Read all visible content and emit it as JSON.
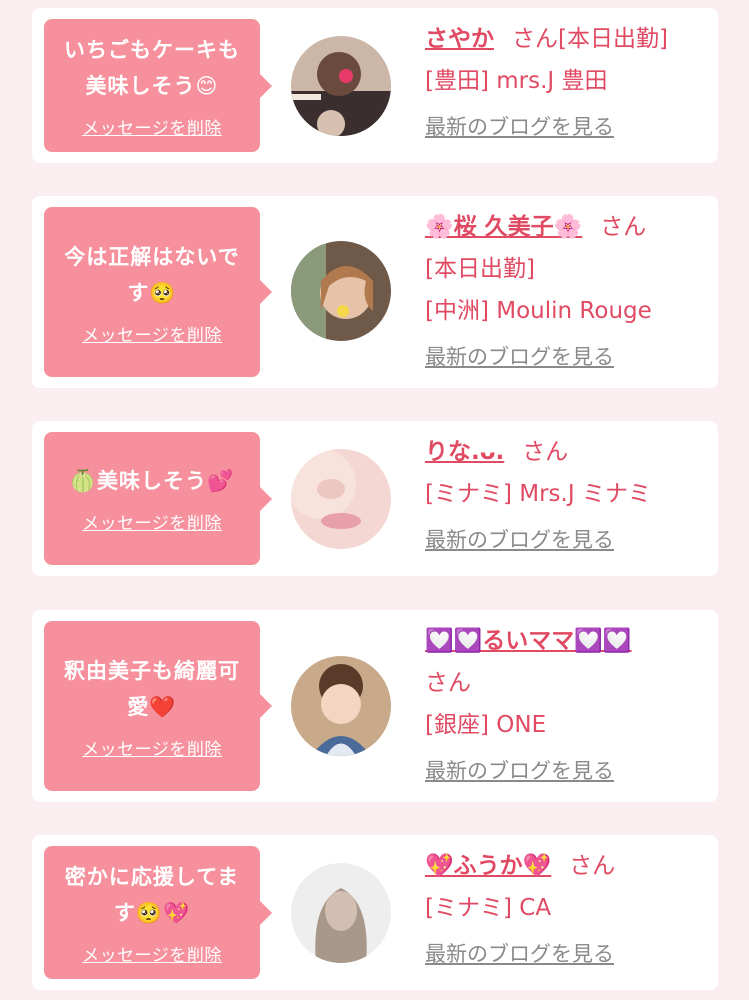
{
  "delete_label": "メッセージを削除",
  "blog_label": "最新のブログを見る",
  "honorific": "さん",
  "items": [
    {
      "message": "いちごもケーキも美味しそう😊",
      "name": "さやか",
      "shift": "[本日出勤]",
      "shop": "[豊田] mrs.J 豊田"
    },
    {
      "message": "今は正解はないです🥺",
      "name": "🌸桜 久美子🌸",
      "shift": "[本日出勤]",
      "shop": "[中洲] Moulin Rouge"
    },
    {
      "message": "🍈美味しそう💕",
      "name": "りな.ᴗ.",
      "shift": "",
      "shop": "[ミナミ] Mrs.J ミナミ"
    },
    {
      "message": "釈由美子も綺麗可愛❤️",
      "name": "💟💟るいママ💟💟",
      "shift": "",
      "shop": "[銀座] ONE"
    },
    {
      "message": "密かに応援してます🥺💖",
      "name": "💖ふうか💖",
      "shift": "",
      "shop": "[ミナミ] CA"
    }
  ]
}
